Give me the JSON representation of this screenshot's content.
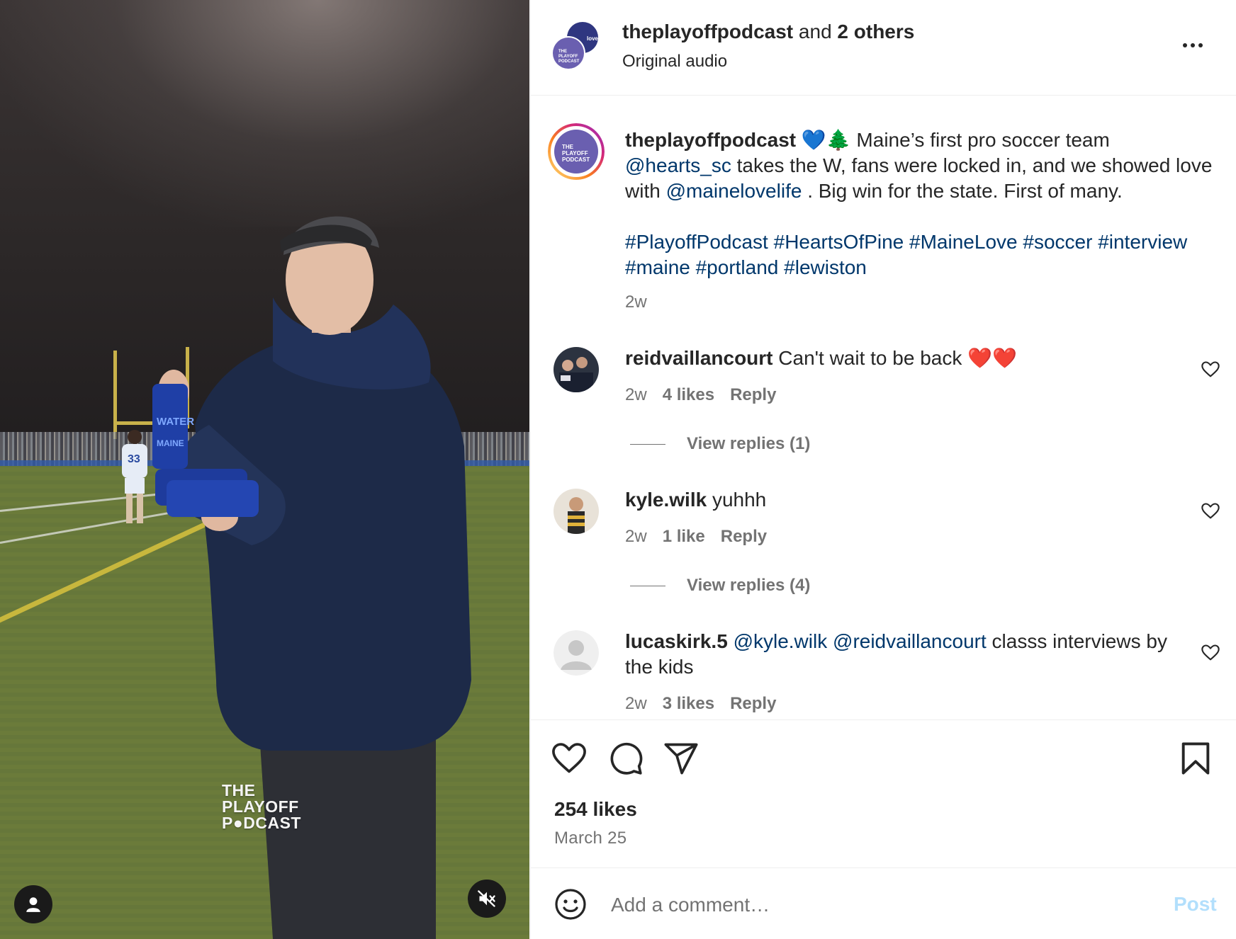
{
  "media": {
    "watermark_lines": [
      "THE",
      "PLAYOFF",
      "P●DCAST"
    ],
    "jersey_number": "33",
    "can_label_1": "WATER",
    "can_label_2": "MAINE",
    "user_button_icon": "person-icon",
    "mute_button_icon": "speaker-muted-icon"
  },
  "header": {
    "username": "theplayoffpodcast",
    "and_text": " and ",
    "others": "2 others",
    "audio": "Original audio",
    "avatar_text": "THE PLAYOFF PODCAST",
    "avatar_text_2": "love",
    "more_icon": "more-dots-icon"
  },
  "caption": {
    "username": "theplayoffpodcast",
    "emoji": "💙🌲",
    "text_1": " Maine’s first pro soccer team ",
    "mention_1": "@hearts_sc",
    "text_2": " takes the W, fans were locked in, and we showed love with ",
    "mention_2": "@mainelovelife",
    "text_3": " . Big win for the state. First of many.",
    "hashtags_line_1": "#PlayoffPodcast #HeartsOfPine #MaineLove #soccer #interview",
    "hashtags_line_2": "#maine #portland #lewiston",
    "time": "2w",
    "avatar_text": "THE PLAYOFF PODCAST"
  },
  "comments": [
    {
      "username": "reidvaillancourt",
      "text": " Can't wait to be back ",
      "emoji": "❤️❤️",
      "time": "2w",
      "likes": "4 likes",
      "reply": "Reply",
      "view_replies": "View replies (1)"
    },
    {
      "username": "kyle.wilk",
      "text": " yuhhh",
      "time": "2w",
      "likes": "1 like",
      "reply": "Reply",
      "view_replies": "View replies (4)"
    },
    {
      "username": "lucaskirk.5",
      "mention_1": "@kyle.wilk",
      "mention_2": "@reidvaillancourt",
      "text": " classs interviews by the kids",
      "time": "2w",
      "likes": "3 likes",
      "reply": "Reply"
    }
  ],
  "actions": {
    "like_icon": "heart-icon",
    "comment_icon": "comment-icon",
    "share_icon": "send-icon",
    "save_icon": "bookmark-icon"
  },
  "stats": {
    "likes": "254 likes",
    "date": "March 25"
  },
  "add_comment": {
    "placeholder": "Add a comment…",
    "post_label": "Post",
    "emoji_icon": "smiley-icon"
  },
  "colors": {
    "link": "#00376b",
    "muted": "#737373",
    "post_disabled": "#b2dffc",
    "podcast_purple": "#6a5fb0"
  }
}
